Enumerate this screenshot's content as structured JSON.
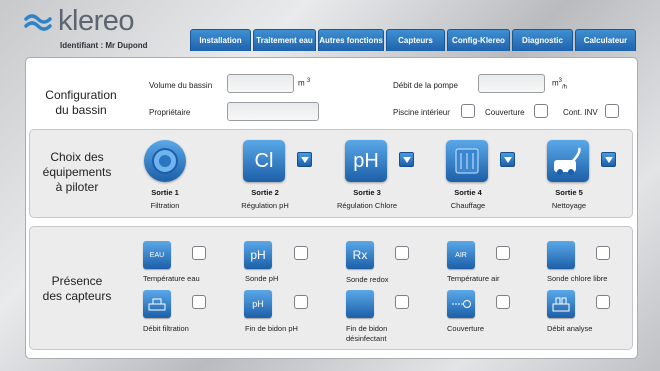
{
  "header": {
    "logo_text": "klereo",
    "identifiant": "Identifiant : Mr Dupond"
  },
  "tabs": [
    {
      "label": "Installation",
      "active": true
    },
    {
      "label": "Traitement eau",
      "active": false
    },
    {
      "label": "Autres fonctions",
      "active": false
    },
    {
      "label": "Capteurs",
      "active": false
    },
    {
      "label": "Config-Klereo",
      "active": false
    },
    {
      "label": "Diagnostic",
      "active": false
    },
    {
      "label": "Calculateur",
      "active": false
    }
  ],
  "config": {
    "title_line1": "Configuration",
    "title_line2": "du bassin",
    "volume_label": "Volume du bassin",
    "volume_value": "",
    "volume_unit": "m",
    "volume_unit_exp": "3",
    "debit_label": "Débit de la pompe",
    "debit_value": "",
    "debit_unit": "m",
    "debit_unit_exp": "3",
    "debit_unit_sub": "/h",
    "proprietaire_label": "Propriétaire",
    "proprietaire_value": "",
    "piscine_label": "Piscine intérieur",
    "couverture_label": "Couverture",
    "cont_inv_label": "Cont. INV"
  },
  "equipements": {
    "title_line1": "Choix des",
    "title_line2": "équipements",
    "title_line3": "à piloter",
    "items": [
      {
        "name": "Sortie 1",
        "sub": "Filtration",
        "icon": "pump-icon",
        "glyph": ""
      },
      {
        "name": "Sortie 2",
        "sub": "Régulation pH",
        "icon": "chlorine-icon",
        "glyph": "Cl"
      },
      {
        "name": "Sortie 3",
        "sub": "Régulation Chlore",
        "icon": "ph-icon",
        "glyph": "pH"
      },
      {
        "name": "Sortie 4",
        "sub": "Chauffage",
        "icon": "heater-icon",
        "glyph": ""
      },
      {
        "name": "Sortie 5",
        "sub": "Nettoyage",
        "icon": "pool-robot-icon",
        "glyph": ""
      }
    ]
  },
  "capteurs": {
    "title_line1": "Présence",
    "title_line2": "des capteurs",
    "row1": [
      {
        "label": "Température eau",
        "icon": "water-temperature-icon",
        "glyph": "EAU"
      },
      {
        "label": "Sonde pH",
        "icon": "ph-probe-icon",
        "glyph": "pH"
      },
      {
        "label": "Sonde redox",
        "icon": "redox-probe-icon",
        "glyph": "Rx"
      },
      {
        "label": "Température air",
        "icon": "air-temperature-icon",
        "glyph": "AIR"
      },
      {
        "label": "Sonde chlore libre",
        "icon": "chlorine-probe-icon",
        "glyph": ""
      }
    ],
    "row2": [
      {
        "label": "Débit filtration",
        "label2": "",
        "icon": "flow-icon",
        "glyph": ""
      },
      {
        "label": "Fin de bidon pH",
        "label2": "",
        "icon": "ph-canister-icon",
        "glyph": "pH"
      },
      {
        "label": "Fin de bidon",
        "label2": "désinfectant",
        "icon": "disinfectant-canister-icon",
        "glyph": ""
      },
      {
        "label": "Couverture",
        "label2": "",
        "icon": "cover-icon",
        "glyph": ""
      },
      {
        "label": "Débit analyse",
        "label2": "",
        "icon": "analysis-flow-icon",
        "glyph": ""
      }
    ]
  },
  "colors": {
    "tab_blue": "#1e63ad",
    "icon_blue": "#3a86d0"
  }
}
